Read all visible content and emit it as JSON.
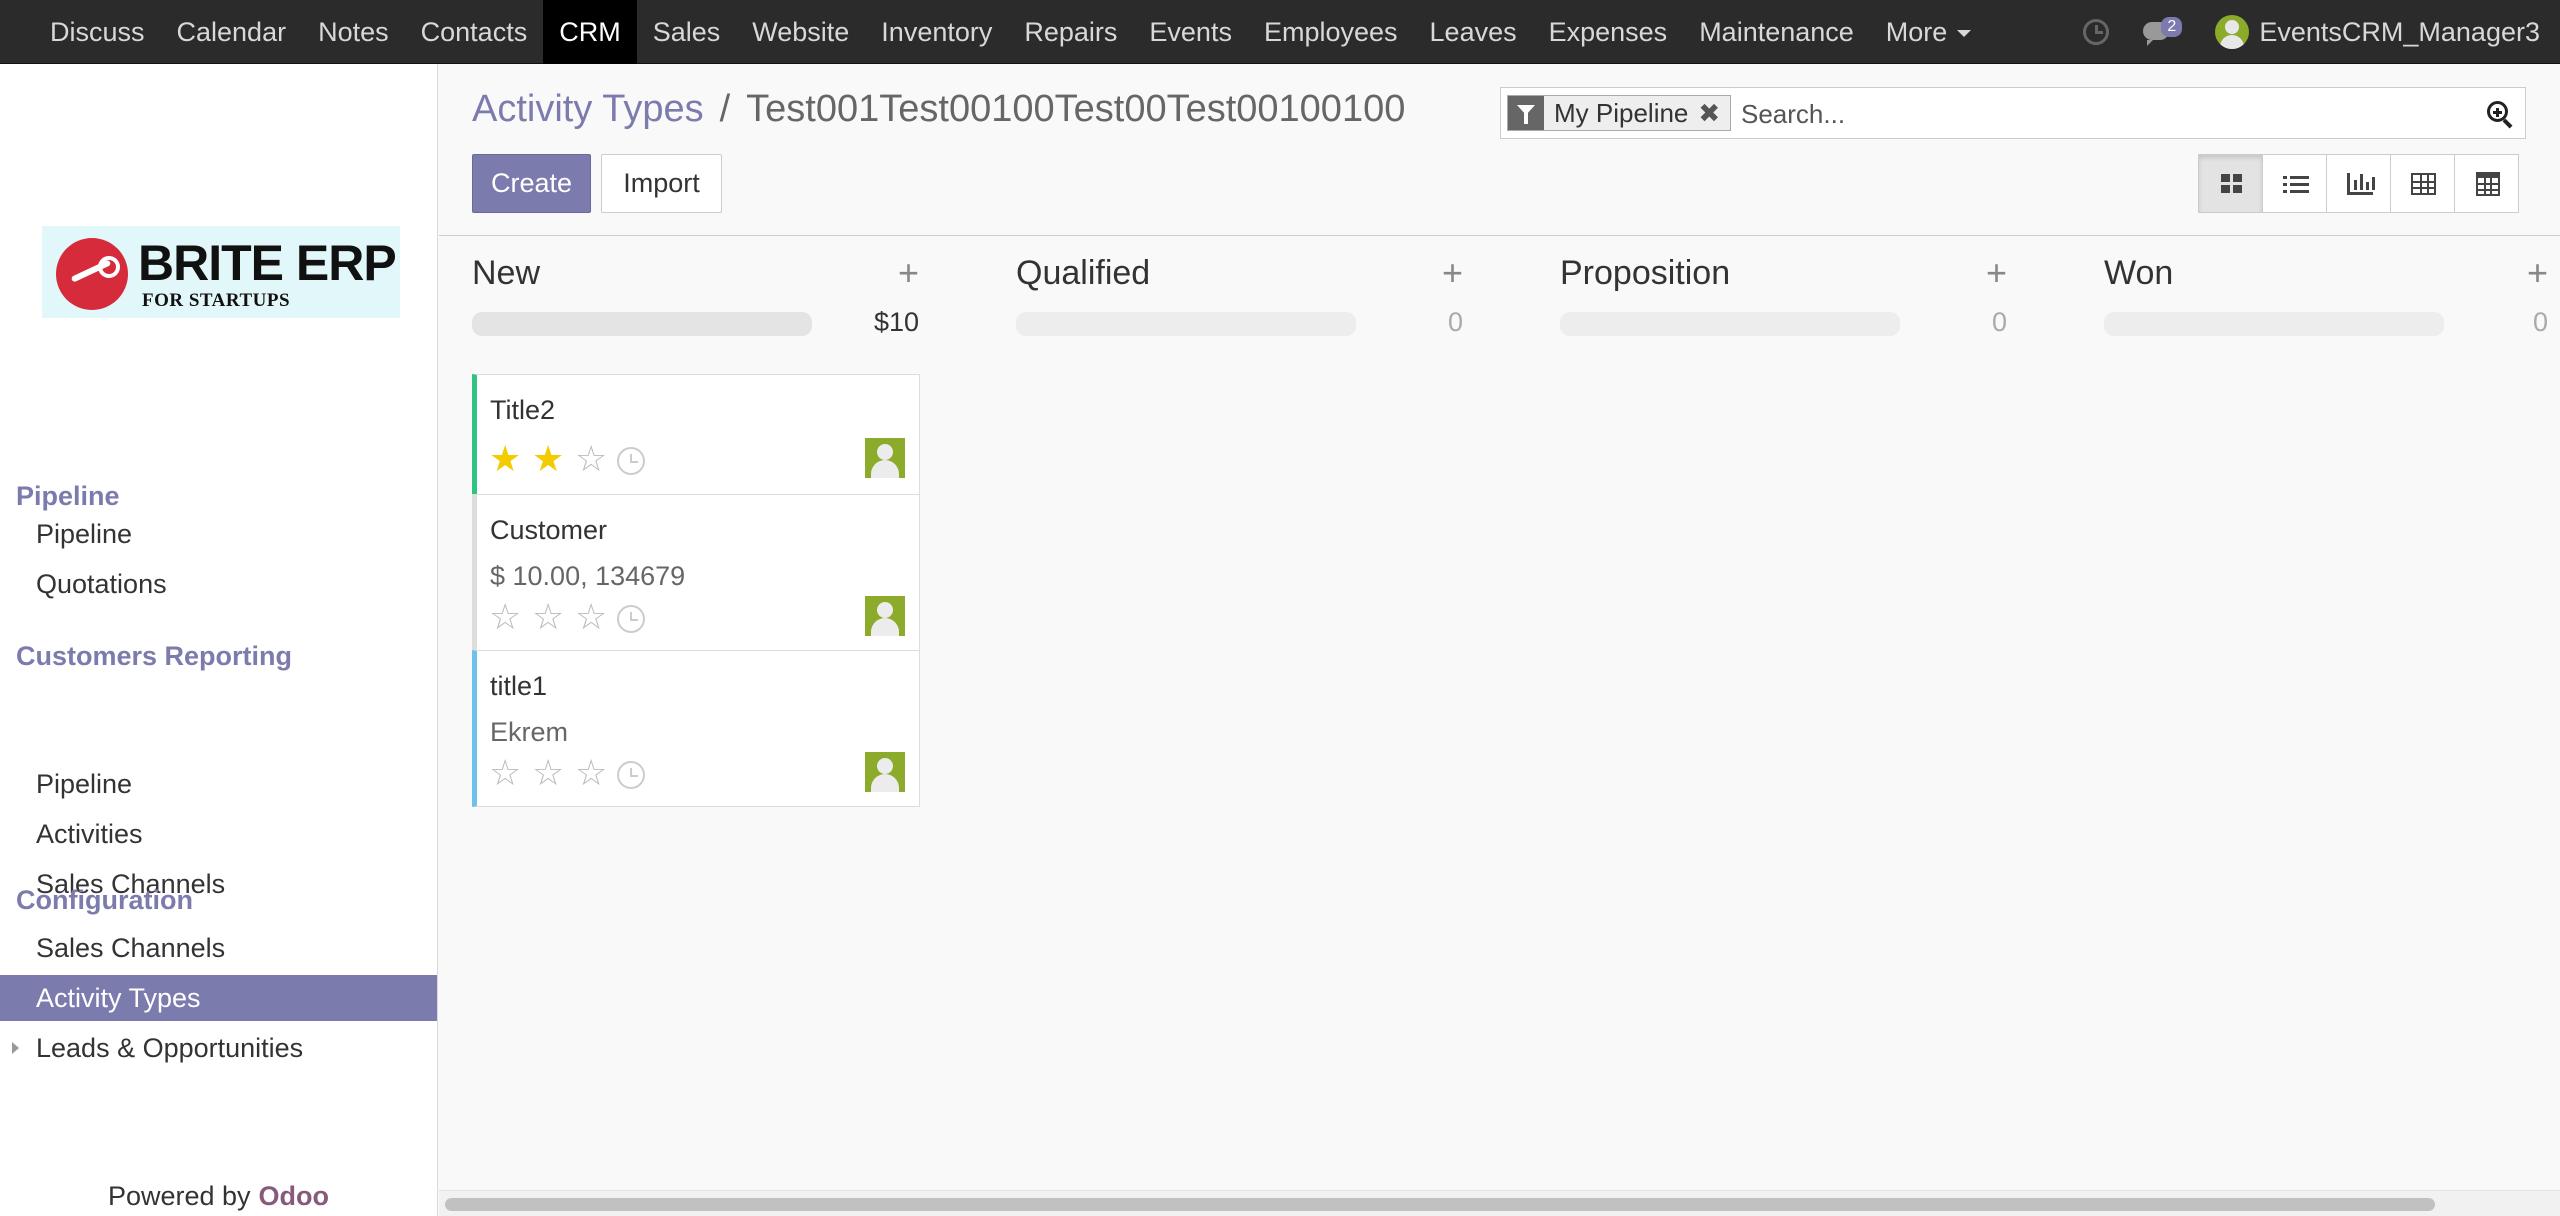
{
  "topbar": {
    "apps": [
      "Discuss",
      "Calendar",
      "Notes",
      "Contacts",
      "CRM",
      "Sales",
      "Website",
      "Inventory",
      "Repairs",
      "Events",
      "Employees",
      "Leaves",
      "Expenses",
      "Maintenance",
      "More"
    ],
    "active_app": "CRM",
    "messages_count": "2",
    "user_name": "EventsCRM_Manager3"
  },
  "sidebar": {
    "logo": {
      "brand": "BRITE ERP",
      "tagline": "FOR STARTUPS"
    },
    "sections": [
      {
        "label": "Pipeline",
        "items": [
          "Pipeline",
          "Quotations"
        ]
      },
      {
        "label": "Customers Reporting",
        "items": [
          "Pipeline",
          "Activities",
          "Sales Channels"
        ]
      },
      {
        "label": "Configuration",
        "items": [
          "Sales Channels",
          "Activity Types",
          "Leads & Opportunities"
        ]
      }
    ],
    "active_item": "Activity Types",
    "powered_by": "Powered by",
    "powered_brand": "Odoo"
  },
  "breadcrumb": {
    "parent": "Activity Types",
    "separator": "/",
    "current": "Test001Test00100Test00Test00100100"
  },
  "search": {
    "facet": "My Pipeline",
    "facet_remove": "✖",
    "placeholder": "Search..."
  },
  "buttons": {
    "create": "Create",
    "import": "Import"
  },
  "view_switcher": {
    "views": [
      "kanban-icon",
      "list-icon",
      "graph-icon",
      "pivot-icon",
      "calendar-icon"
    ],
    "active": "kanban-icon"
  },
  "kanban": {
    "columns": [
      {
        "title": "New",
        "total": "$10",
        "add": "+"
      },
      {
        "title": "Qualified",
        "total": "0",
        "add": "+"
      },
      {
        "title": "Proposition",
        "total": "0",
        "add": "+"
      },
      {
        "title": "Won",
        "total": "0",
        "add": "+"
      }
    ],
    "cards": [
      {
        "title": "Title2",
        "line": "",
        "stars": 2,
        "color": "#30c381"
      },
      {
        "title": "Customer",
        "line": "$ 10.00, 134679",
        "stars": 0,
        "color": "#dddddd"
      },
      {
        "title": "title1",
        "line": "Ekrem",
        "stars": 0,
        "color": "#6cc1ed"
      }
    ]
  }
}
